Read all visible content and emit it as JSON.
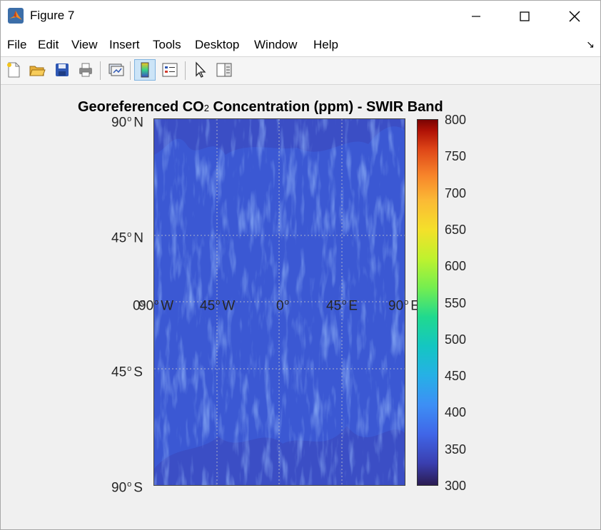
{
  "window": {
    "title": "Figure 7"
  },
  "menu": [
    "File",
    "Edit",
    "View",
    "Insert",
    "Tools",
    "Desktop",
    "Window",
    "Help"
  ],
  "toolbar_icons": [
    "new-figure-icon",
    "open-file-icon",
    "save-icon",
    "print-icon",
    "link-plot-icon",
    "colorbar-icon",
    "legend-icon",
    "pointer-icon",
    "property-inspector-icon"
  ],
  "figure": {
    "title_pre": "Georeferenced CO",
    "title_sub": "2",
    "title_post": " Concentration (ppm) - SWIR Band",
    "lat_labels": [
      {
        "num": "90",
        "dir": "N"
      },
      {
        "num": "45",
        "dir": "N"
      },
      {
        "num": "45",
        "dir": "S"
      },
      {
        "num": "90",
        "dir": "S"
      }
    ],
    "lon_labels": [
      {
        "num": "0",
        "dir": ""
      },
      {
        "num": "90",
        "dir": "W"
      },
      {
        "num": "45",
        "dir": "W"
      },
      {
        "num": "0",
        "dir": ""
      },
      {
        "num": "45",
        "dir": "E"
      },
      {
        "num": "90",
        "dir": "E"
      }
    ]
  },
  "chart_data": {
    "type": "heatmap",
    "title": "Georeferenced CO2 Concentration (ppm) - SWIR Band",
    "colormap": "turbo",
    "clim": [
      300,
      800
    ],
    "colorbar_ticks": [
      800,
      750,
      700,
      650,
      600,
      550,
      500,
      450,
      400,
      350,
      300
    ],
    "lat_ticks": [
      "90° N",
      "45° N",
      "0°",
      "45° S",
      "90° S"
    ],
    "lon_ticks": [
      "90° W",
      "45° W",
      "0°",
      "45° E",
      "90° E"
    ],
    "dominant_value_range": [
      350,
      420
    ],
    "grid": true
  },
  "colors": {
    "axes_fill": "#3b4ec5",
    "grid": "#c8c8c8",
    "background": "#f0f0f0"
  }
}
